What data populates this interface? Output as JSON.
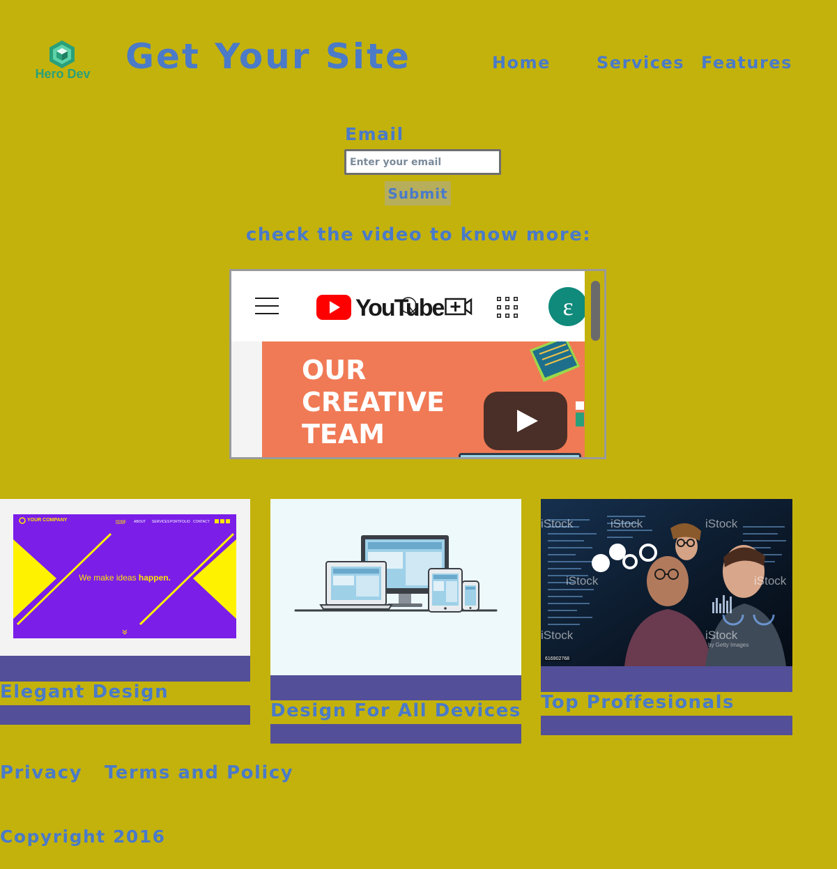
{
  "header": {
    "logo_text": "Hero Dev",
    "site_title": "Get Your Site",
    "nav": {
      "home": "Home",
      "services": "Services",
      "features": "Features"
    }
  },
  "form": {
    "email_label": "Email",
    "email_placeholder": "Enter your email",
    "email_value": "",
    "submit_label": "Submit"
  },
  "video": {
    "caption": "check the video to know more:",
    "youtube_wordmark": "YouTube",
    "avatar_initial": "ε",
    "thumbnail_lines": [
      "OUR",
      "CREATIVE",
      "TEAM"
    ]
  },
  "cards": [
    {
      "title": "Elegant Design",
      "image": {
        "brand": "YOUR COMPANY",
        "nav": [
          "HOME",
          "ABOUT",
          "SERVICES",
          "PORTFOLIO",
          "CONTACT"
        ],
        "tagline_plain": "We make ideas ",
        "tagline_bold": "happen."
      }
    },
    {
      "title": "Design For All Devices"
    },
    {
      "title": "Top Proffesionals",
      "image": {
        "watermark": "iStock",
        "watermark_sub": "by Getty Images",
        "stock_id": "616902768"
      }
    }
  ],
  "footer": {
    "privacy": "Privacy",
    "terms": "Terms and Policy",
    "copyright": "Copyright 2016"
  },
  "colors": {
    "page_background": "#c4b20c",
    "text_blue": "#4a7ac8",
    "card_bar": "#534f98",
    "logo_green": "#2aa07a",
    "submit_background": "#b7ae5b"
  }
}
